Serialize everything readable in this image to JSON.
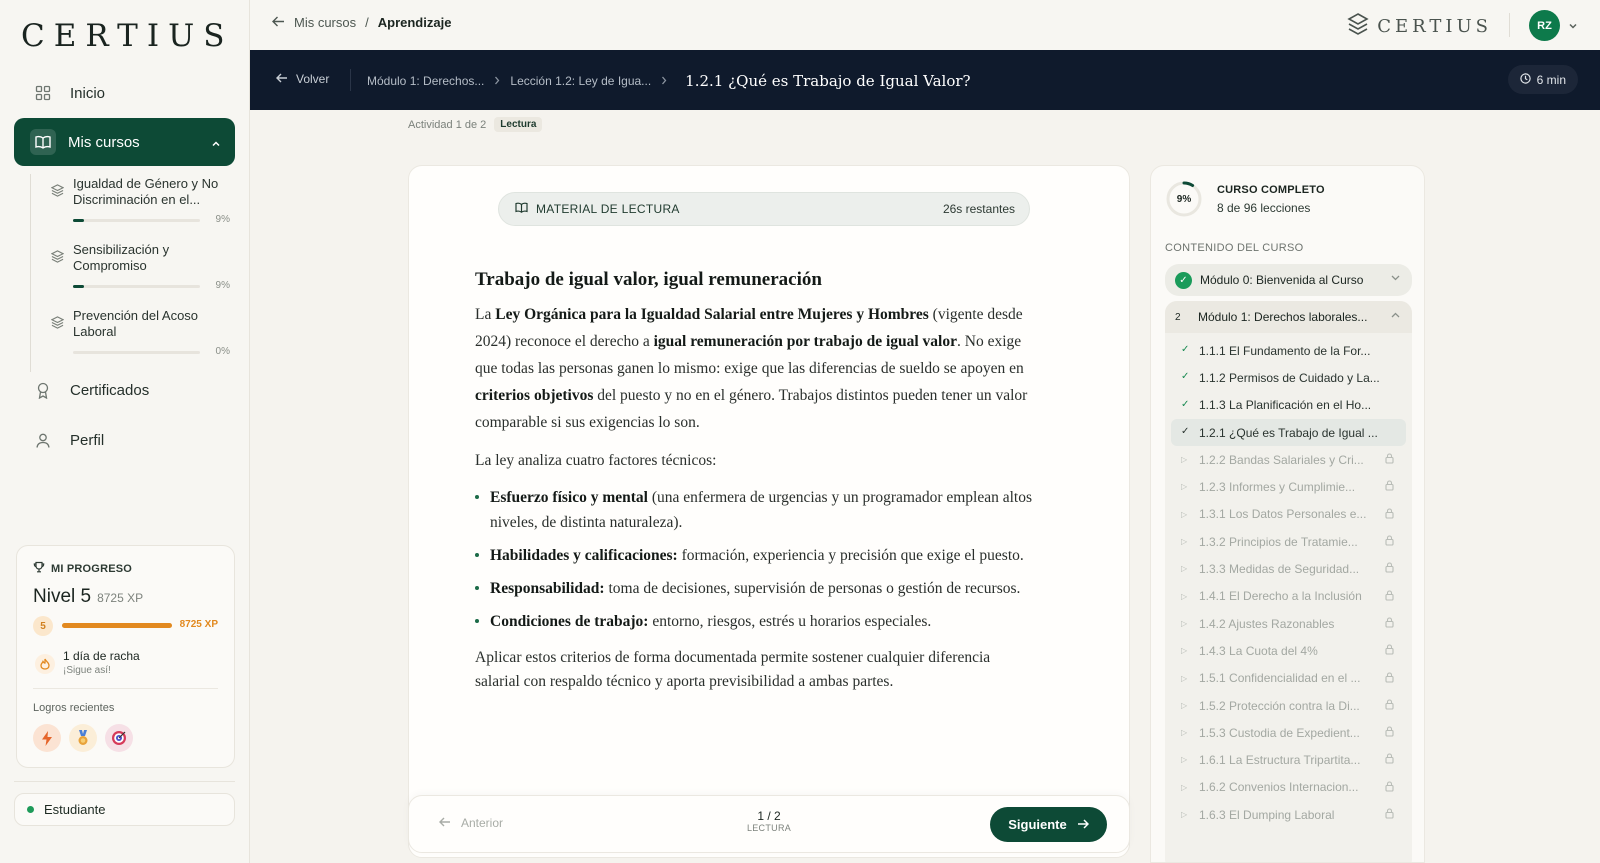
{
  "app": {
    "logo": "CERTIUS"
  },
  "sidebar": {
    "nav": {
      "home": "Inicio",
      "courses": "Mis cursos",
      "certificates": "Certificados",
      "profile": "Perfil"
    },
    "courses": [
      {
        "title": "Igualdad de Género y No Discriminación en el...",
        "progress": 9,
        "pct_label": "9%"
      },
      {
        "title": "Sensibilización y Compromiso",
        "progress": 9,
        "pct_label": "9%"
      },
      {
        "title": "Prevención del Acoso Laboral",
        "progress": 0,
        "pct_label": "0%"
      }
    ],
    "progress_card": {
      "heading": "MI PROGRESO",
      "level": "Nivel 5",
      "xp": "8725 XP",
      "level_num": "5",
      "xp_label": "8725 XP",
      "xp_fill": 1.0,
      "streak": "1 día de racha",
      "streak_sub": "¡Sigue así!",
      "achievements_label": "Logros recientes",
      "badges": [
        "lightning-badge",
        "medal-badge",
        "target-badge"
      ]
    },
    "role": "Estudiante"
  },
  "topbar": {
    "breadcrumb_parent": "Mis cursos",
    "breadcrumb_sep": "/",
    "breadcrumb_current": "Aprendizaje",
    "brand": "CERTIUS",
    "avatar_initials": "RZ"
  },
  "lesson_header": {
    "back": "Volver",
    "module": "Módulo 1: Derechos...",
    "lesson": "Lección 1.2: Ley de Igua...",
    "title": "1.2.1 ¿Qué es Trabajo de Igual Valor?",
    "time": "6 min"
  },
  "activity": {
    "label": "Actividad 1 de 2",
    "tag": "Lectura"
  },
  "reading": {
    "material_label": "MATERIAL DE LECTURA",
    "remaining": "26s restantes",
    "heading": "Trabajo de igual valor, igual remuneración",
    "p1_a": "La ",
    "p1_b": "Ley Orgánica para la Igualdad Salarial entre Mujeres y Hombres",
    "p1_c": " (vigente desde 2024) reconoce el derecho a ",
    "p1_d": "igual remuneración por trabajo de igual valor",
    "p1_e": ". No exige que todas las personas ganen lo mismo: exige que las diferencias de sueldo se apoyen en ",
    "p1_f": "criterios objetivos",
    "p1_g": " del puesto y no en el género. Trabajos distintos pueden tener un valor comparable si sus exigencias lo son.",
    "p2": "La ley analiza cuatro factores técnicos:",
    "factors": [
      {
        "name": "Esfuerzo físico y mental",
        "text": " (una enfermera de urgencias y un programador emplean altos niveles, de distinta naturaleza)."
      },
      {
        "name": "Habilidades y calificaciones:",
        "text": " formación, experiencia y precisión que exige el puesto."
      },
      {
        "name": "Responsabilidad:",
        "text": " toma de decisiones, supervisión de personas o gestión de recursos."
      },
      {
        "name": "Condiciones de trabajo:",
        "text": " entorno, riesgos, estrés u horarios especiales."
      }
    ],
    "p3": "Aplicar estos criterios de forma documentada permite sostener cualquier diferencia salarial con respaldo técnico y aporta previsibilidad a ambas partes."
  },
  "footer": {
    "prev": "Anterior",
    "page": "1 / 2",
    "page_type": "LECTURA",
    "next": "Siguiente"
  },
  "course_panel": {
    "percent": "9%",
    "percent_value": 9,
    "title": "CURSO COMPLETO",
    "subtitle": "8 de 96 lecciones",
    "contents_label": "CONTENIDO DEL CURSO",
    "module0": "Módulo 0: Bienvenida al Curso",
    "module1_num": "2",
    "module1": "Módulo 1: Derechos laborales...",
    "lessons": [
      {
        "label": "1.1.1 El Fundamento de la For...",
        "state": "done"
      },
      {
        "label": "1.1.2 Permisos de Cuidado y La...",
        "state": "done"
      },
      {
        "label": "1.1.3 La Planificación en el Ho...",
        "state": "done"
      },
      {
        "label": "1.2.1 ¿Qué es Trabajo de Igual ...",
        "state": "current"
      },
      {
        "label": "1.2.2 Bandas Salariales y Cri...",
        "state": "locked"
      },
      {
        "label": "1.2.3 Informes y Cumplimie...",
        "state": "locked"
      },
      {
        "label": "1.3.1 Los Datos Personales e...",
        "state": "locked"
      },
      {
        "label": "1.3.2 Principios de Tratamie...",
        "state": "locked"
      },
      {
        "label": "1.3.3 Medidas de Seguridad...",
        "state": "locked"
      },
      {
        "label": "1.4.1 El Derecho a la Inclusión",
        "state": "locked"
      },
      {
        "label": "1.4.2 Ajustes Razonables",
        "state": "locked"
      },
      {
        "label": "1.4.3 La Cuota del 4%",
        "state": "locked"
      },
      {
        "label": "1.5.1 Confidencialidad en el ...",
        "state": "locked"
      },
      {
        "label": "1.5.2 Protección contra la Di...",
        "state": "locked"
      },
      {
        "label": "1.5.3 Custodia de Expedient...",
        "state": "locked"
      },
      {
        "label": "1.6.1 La Estructura Tripartita...",
        "state": "locked"
      },
      {
        "label": "1.6.2 Convenios Internacion...",
        "state": "locked"
      },
      {
        "label": "1.6.3 El Dumping Laboral",
        "state": "locked"
      }
    ]
  },
  "colors": {
    "primary": "#0d4a36",
    "header_bg": "#0f1a2c",
    "accent": "#e2891f",
    "success": "#1a9b5a"
  }
}
